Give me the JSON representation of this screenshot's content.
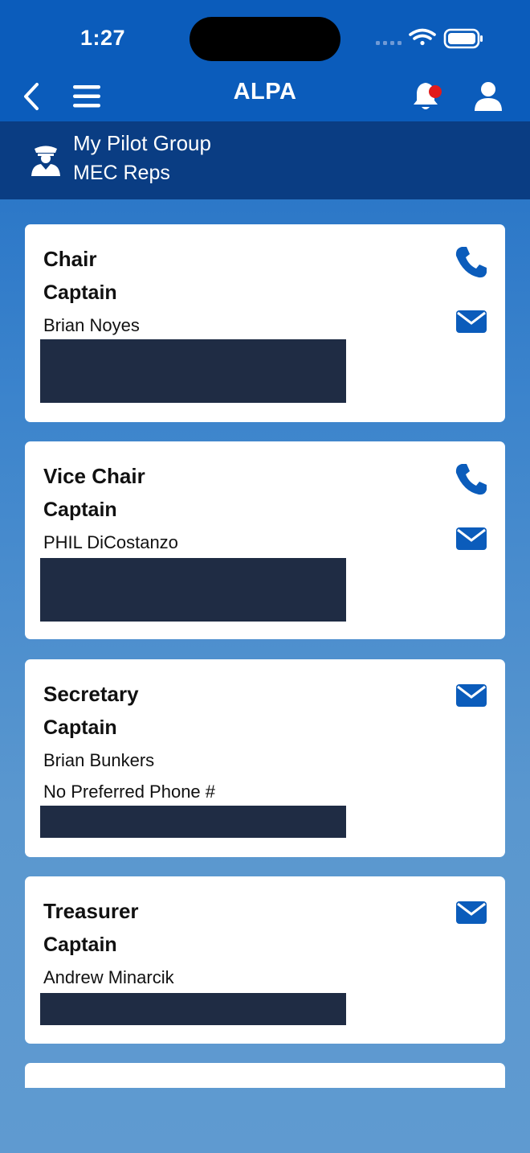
{
  "status_bar": {
    "time": "1:27"
  },
  "nav": {
    "title": "ALPA"
  },
  "group": {
    "title": "My Pilot Group",
    "subtitle": "MEC Reps"
  },
  "colors": {
    "brand": "#0b5cbb",
    "header_dark": "#0a3d83",
    "accent_icon": "#0b5cbb",
    "notification_dot": "#e11b1b",
    "redaction": "#1f2c44"
  },
  "icons": [
    "back-chevron-icon",
    "menu-icon",
    "bell-icon",
    "user-icon",
    "pilot-icon",
    "phone-icon",
    "mail-icon"
  ],
  "reps": [
    {
      "role": "Chair",
      "rank": "Captain",
      "name": "Brian Noyes",
      "note": "",
      "has_phone": true
    },
    {
      "role": "Vice Chair",
      "rank": "Captain",
      "name": "PHIL DiCostanzo",
      "note": "",
      "has_phone": true
    },
    {
      "role": "Secretary",
      "rank": "Captain",
      "name": "Brian Bunkers",
      "note": "No Preferred Phone #",
      "has_phone": false
    },
    {
      "role": "Treasurer",
      "rank": "Captain",
      "name": "Andrew Minarcik",
      "note": "",
      "has_phone": false
    }
  ]
}
